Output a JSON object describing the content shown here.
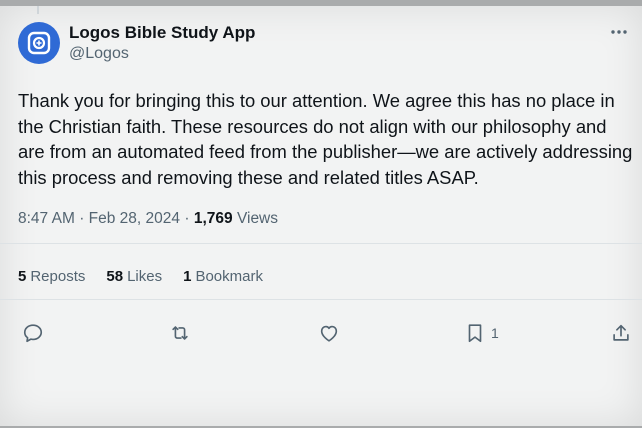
{
  "tweet": {
    "author_name": "Logos Bible Study App",
    "author_handle": "@Logos",
    "text": "Thank you for bringing this to our attention. We agree this has no place in the Christian faith. These resources do not align with our philosophy and are from an automated feed from the publisher—we are actively addressing this process and removing these and related titles ASAP.",
    "time": "8:47 AM",
    "separator": "·",
    "date": "Feb 28, 2024",
    "views_count": "1,769",
    "views_label": "Views"
  },
  "stats": {
    "reposts_count": "5",
    "reposts_label": "Reposts",
    "likes_count": "58",
    "likes_label": "Likes",
    "bookmarks_count": "1",
    "bookmarks_label": "Bookmark"
  },
  "actions": {
    "bookmark_count": "1"
  },
  "colors": {
    "avatar": "#2f6ad5",
    "text": "#0f1419",
    "muted": "#536471"
  }
}
